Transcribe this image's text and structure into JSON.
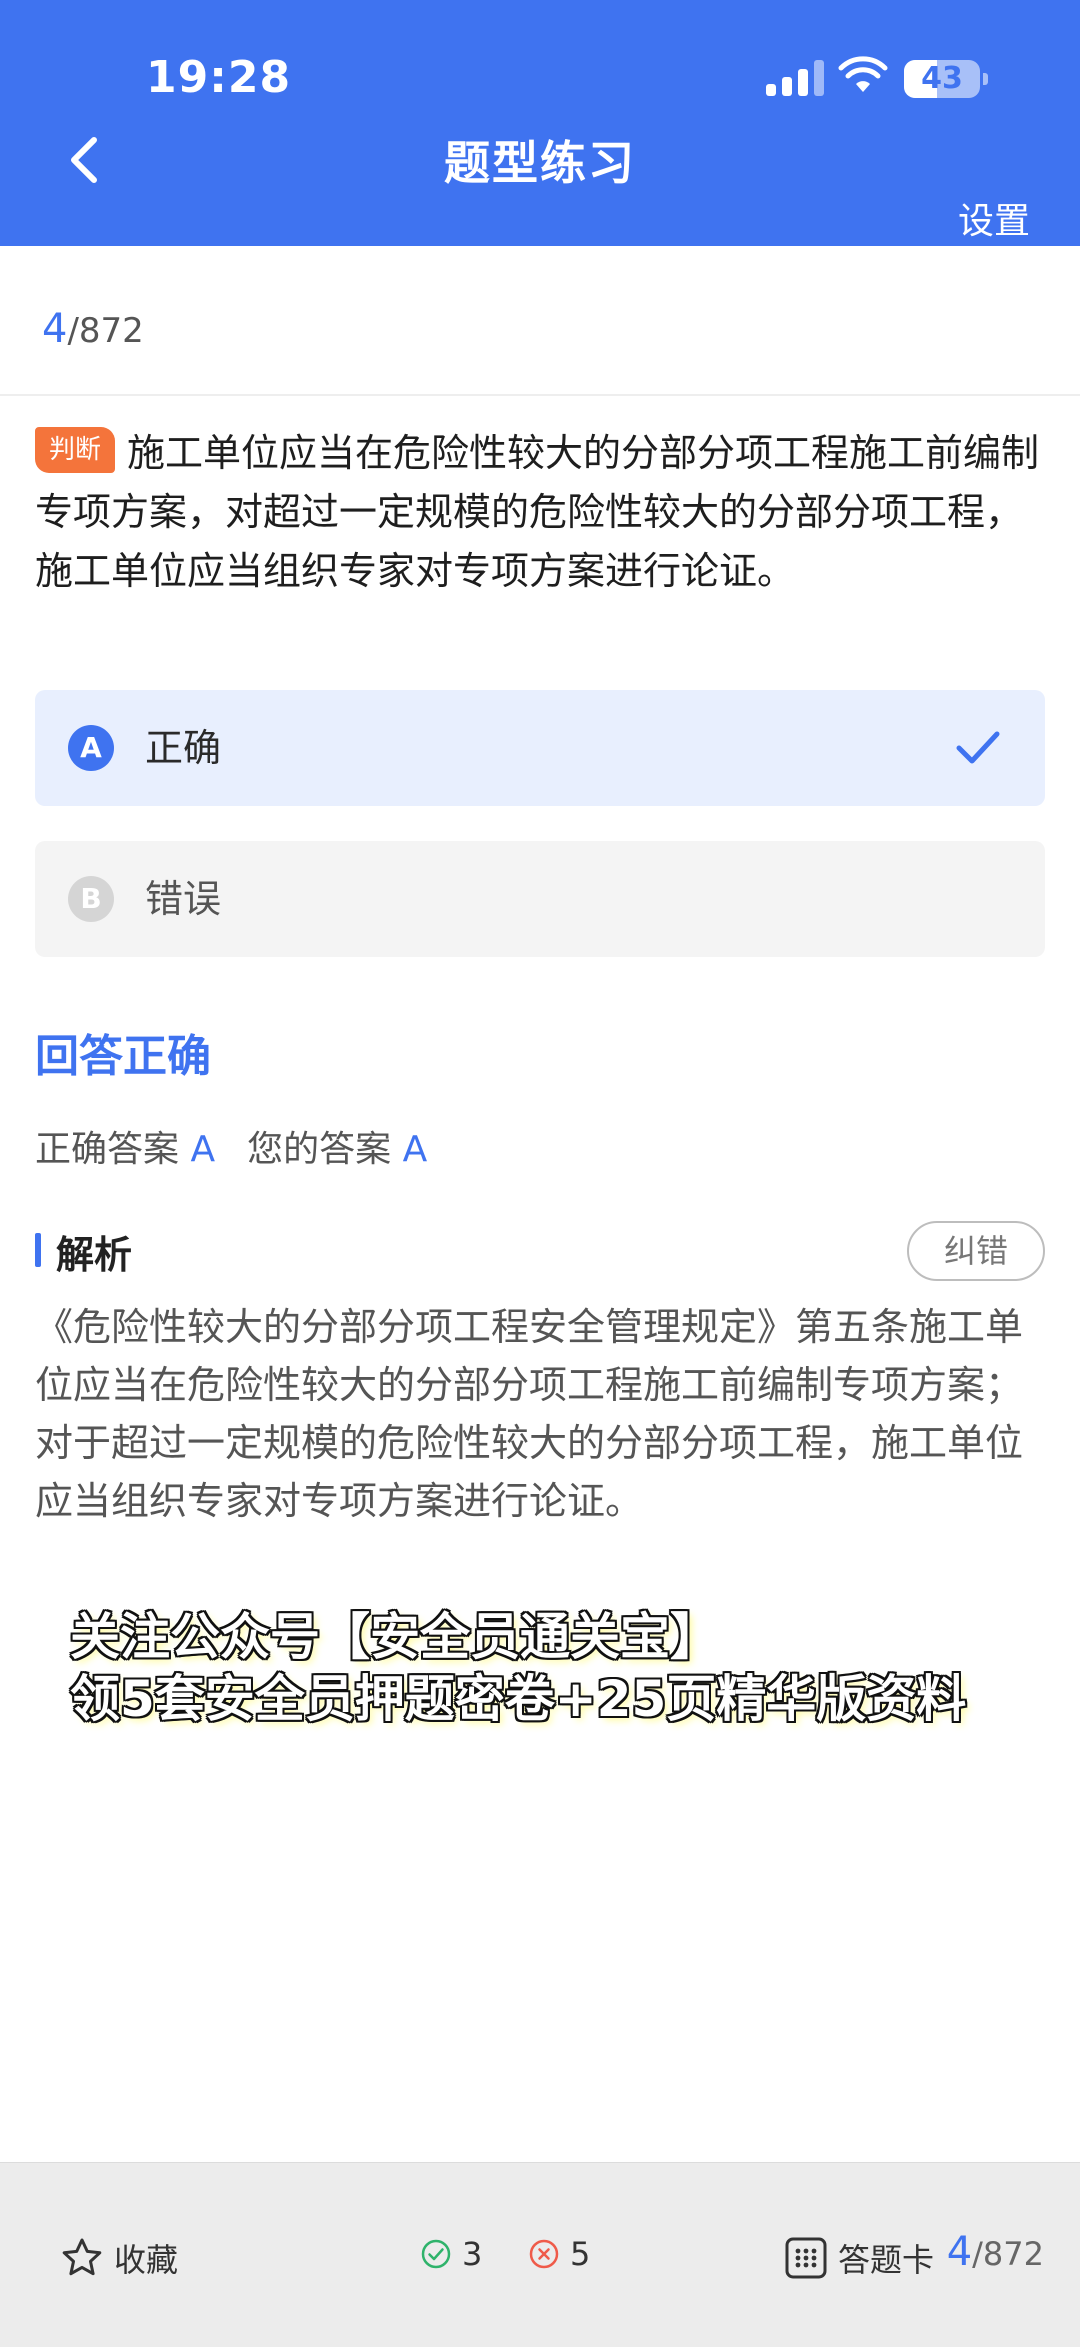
{
  "status_bar": {
    "time": "19:28",
    "battery": "43",
    "battery_level": 0.43
  },
  "nav": {
    "title": "题型练习",
    "settings_label": "设置"
  },
  "progress": {
    "current": "4",
    "total": "/872"
  },
  "question": {
    "type_label": "判断",
    "text": "施工单位应当在危险性较大的分部分项工程施工前编制专项方案，对超过一定规模的危险性较大的分部分项工程，施工单位应当组织专家对专项方案进行论证。"
  },
  "options": [
    {
      "letter": "A",
      "text": "正确",
      "selected": true
    },
    {
      "letter": "B",
      "text": "错误",
      "selected": false
    }
  ],
  "result": {
    "status": "回答正确",
    "correct_label": "正确答案",
    "correct_value": "A",
    "yours_label": "您的答案",
    "yours_value": "A"
  },
  "analysis": {
    "title": "解析",
    "correction_label": "纠错",
    "text": "《危险性较大的分部分项工程安全管理规定》第五条施工单位应当在危险性较大的分部分项工程施工前编制专项方案；对于超过一定规模的危险性较大的分部分项工程，施工单位应当组织专家对专项方案进行论证。"
  },
  "promo": {
    "line1": "关注公众号【安全员通关宝】",
    "line2": "领5套安全员押题密卷+25页精华版资料"
  },
  "bottom_bar": {
    "favorite_label": "收藏",
    "correct_count": "3",
    "wrong_count": "5",
    "answer_card_label": "答题卡",
    "progress_current": "4",
    "progress_total": "/872"
  },
  "colors": {
    "primary": "#3f73f0",
    "tag": "#f4743b",
    "correct": "#2fb36b",
    "wrong": "#ef5b4a"
  }
}
